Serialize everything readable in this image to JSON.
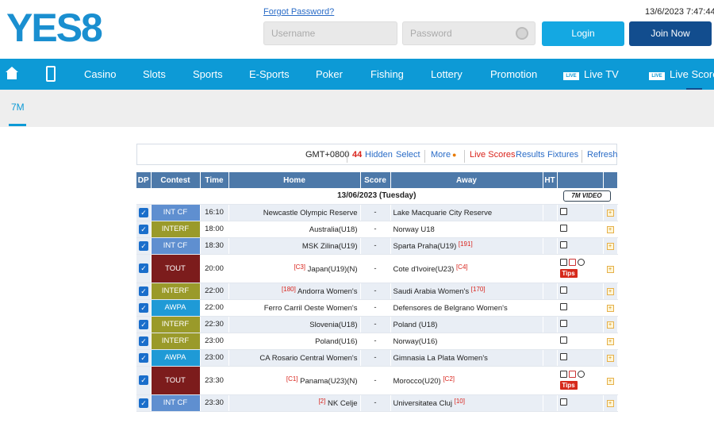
{
  "header": {
    "logo_text": "YES8",
    "forgot_password": "Forgot Password?",
    "username_placeholder": "Username",
    "password_placeholder": "Password",
    "login_label": "Login",
    "join_label": "Join Now",
    "datetime": "13/6/2023 7:47:44"
  },
  "nav": {
    "items": [
      "Casino",
      "Slots",
      "Sports",
      "E-Sports",
      "Poker",
      "Fishing",
      "Lottery",
      "Promotion",
      "Live TV",
      "Live Score"
    ],
    "live_badge": "LIVE"
  },
  "subtab": {
    "label": "7M"
  },
  "toolbar": {
    "timezone": "GMT+0800",
    "hidden_count": "44",
    "hidden_label": "Hidden",
    "select_label": "Select",
    "more_label": "More",
    "live_scores": "Live Scores",
    "results": "Results",
    "fixtures": "Fixtures",
    "refresh": "Refresh"
  },
  "table": {
    "headers": {
      "dp": "DP",
      "contest": "Contest",
      "time": "Time",
      "home": "Home",
      "score": "Score",
      "away": "Away",
      "ht": "HT"
    },
    "date_label": "13/06/2023 (Tuesday)",
    "video_label": "7M VIDEO",
    "tips_label": "Tips",
    "rows": [
      {
        "contest": "INT CF",
        "color": "#5f8fd0",
        "time": "16:10",
        "home": "Newcastle Olympic Reserve",
        "home_rank": "",
        "score": "-",
        "away": "Lake Macquarie City Reserve",
        "away_rank": "",
        "tips": false
      },
      {
        "contest": "INTERF",
        "color": "#9a9a2a",
        "time": "18:00",
        "home": "Australia(U18)",
        "home_rank": "",
        "score": "-",
        "away": "Norway U18",
        "away_rank": "",
        "tips": false
      },
      {
        "contest": "INT CF",
        "color": "#5f8fd0",
        "time": "18:30",
        "home": "MSK Zilina(U19)",
        "home_rank": "",
        "score": "-",
        "away": "Sparta Praha(U19)",
        "away_rank": "[191]",
        "tips": false
      },
      {
        "contest": "TOUT",
        "color": "#7c1c1c",
        "time": "20:00",
        "home": "Japan(U19)(N)",
        "home_rank": "[C3]",
        "score": "-",
        "away": "Cote d'Ivoire(U23)",
        "away_rank": "[C4]",
        "tips": true
      },
      {
        "contest": "INTERF",
        "color": "#9a9a2a",
        "time": "22:00",
        "home": "Andorra Women's",
        "home_rank": "[180]",
        "score": "-",
        "away": "Saudi Arabia Women's",
        "away_rank": "[170]",
        "tips": false
      },
      {
        "contest": "AWPA",
        "color": "#1f9ad6",
        "time": "22:00",
        "home": "Ferro Carril Oeste Women's",
        "home_rank": "",
        "score": "-",
        "away": "Defensores de Belgrano Women's",
        "away_rank": "",
        "tips": false
      },
      {
        "contest": "INTERF",
        "color": "#9a9a2a",
        "time": "22:30",
        "home": "Slovenia(U18)",
        "home_rank": "",
        "score": "-",
        "away": "Poland (U18)",
        "away_rank": "",
        "tips": false
      },
      {
        "contest": "INTERF",
        "color": "#9a9a2a",
        "time": "23:00",
        "home": "Poland(U16)",
        "home_rank": "",
        "score": "-",
        "away": "Norway(U16)",
        "away_rank": "",
        "tips": false
      },
      {
        "contest": "AWPA",
        "color": "#1f9ad6",
        "time": "23:00",
        "home": "CA Rosario Central Women's",
        "home_rank": "",
        "score": "-",
        "away": "Gimnasia La Plata Women's",
        "away_rank": "",
        "tips": false
      },
      {
        "contest": "TOUT",
        "color": "#7c1c1c",
        "time": "23:30",
        "home": "Panama(U23)(N)",
        "home_rank": "[C1]",
        "score": "-",
        "away": "Morocco(U20)",
        "away_rank": "[C2]",
        "tips": true
      },
      {
        "contest": "INT CF",
        "color": "#5f8fd0",
        "time": "23:30",
        "home": "NK Celje",
        "home_rank": "[2]",
        "score": "-",
        "away": "Universitatea Cluj",
        "away_rank": "[10]",
        "tips": false
      }
    ]
  },
  "colors": {
    "brand_blue": "#0d9ad6",
    "navy": "#124d8e",
    "header_blue": "#4d79a9",
    "alert_red": "#d9231b"
  }
}
